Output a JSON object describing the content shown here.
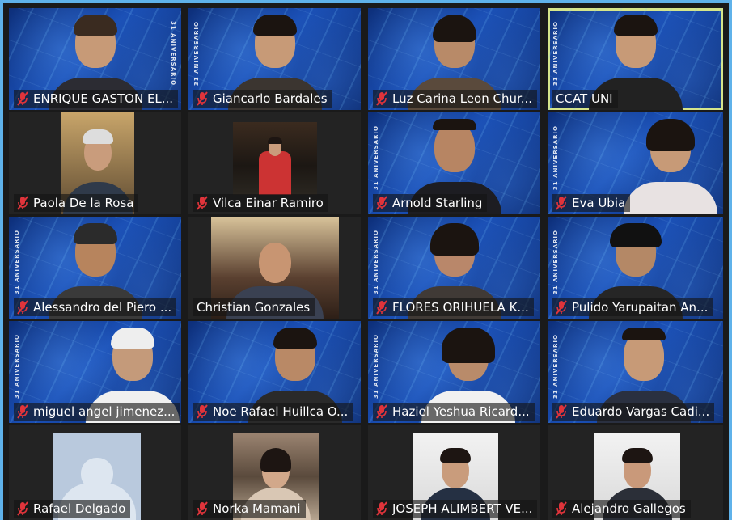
{
  "icons": {
    "muted": "mic-muted-icon"
  },
  "colors": {
    "frame": "#5fb2ea",
    "active_speaker_border": "#d6e58a",
    "mute_red": "#e0343b"
  },
  "badge_text": "31 ANIVERSARIO",
  "participants": [
    {
      "name": "ENRIQUE GASTON EL...",
      "muted": true
    },
    {
      "name": "Giancarlo Bardales",
      "muted": true
    },
    {
      "name": "Luz Carina Leon Chur...",
      "muted": true
    },
    {
      "name": "CCAT UNI",
      "muted": false
    },
    {
      "name": "Paola De la Rosa",
      "muted": true
    },
    {
      "name": "Vilca Einar Ramiro",
      "muted": true
    },
    {
      "name": "Arnold Starling",
      "muted": true
    },
    {
      "name": "Eva Ubia",
      "muted": true
    },
    {
      "name": "Alessandro del Piero ...",
      "muted": true
    },
    {
      "name": "Christian Gonzales",
      "muted": false
    },
    {
      "name": "FLORES ORIHUELA K...",
      "muted": true
    },
    {
      "name": "Pulido Yarupaitan An...",
      "muted": true
    },
    {
      "name": "miguel angel jimenez...",
      "muted": true
    },
    {
      "name": "Noe Rafael Huillca O...",
      "muted": true
    },
    {
      "name": "Haziel Yeshua Ricard...",
      "muted": true
    },
    {
      "name": "Eduardo Vargas Cadi...",
      "muted": true
    },
    {
      "name": "Rafael Delgado",
      "muted": true
    },
    {
      "name": "Norka Mamani",
      "muted": true
    },
    {
      "name": "JOSEPH ALIMBERT VE...",
      "muted": true
    },
    {
      "name": "Alejandro Gallegos",
      "muted": true
    }
  ]
}
